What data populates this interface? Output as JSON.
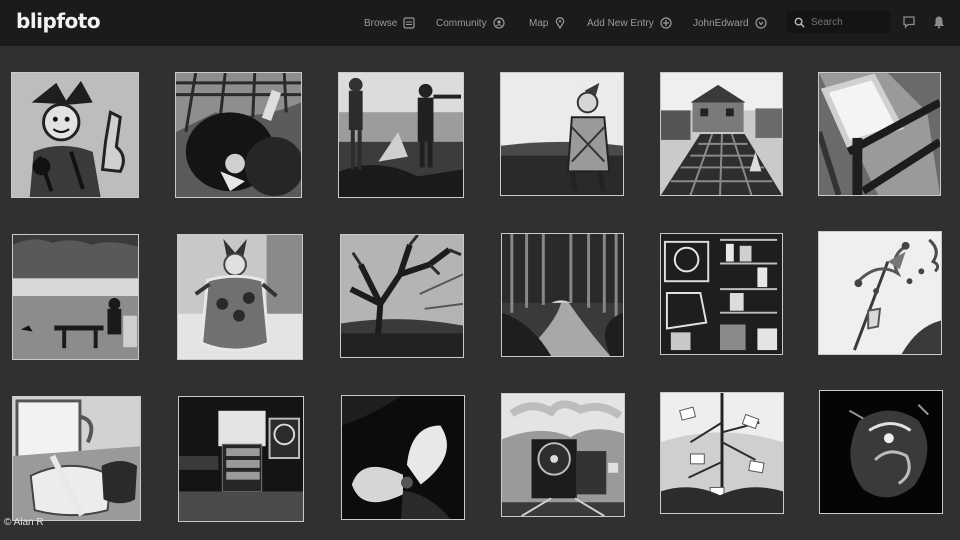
{
  "header": {
    "logo": "blipfoto",
    "nav": [
      {
        "label": "Browse",
        "icon": "browse-grid-icon"
      },
      {
        "label": "Community",
        "icon": "community-icon"
      },
      {
        "label": "Map",
        "icon": "map-pin-icon"
      },
      {
        "label": "Add New Entry",
        "icon": "add-circle-icon"
      },
      {
        "label": "JohnEdward",
        "icon": "user-menu-icon"
      }
    ],
    "search": {
      "placeholder": "Search",
      "icon": "search-icon"
    },
    "icons": [
      "messages-icon",
      "notifications-icon"
    ]
  },
  "gallery": {
    "photos": [
      {
        "subject": "jester-figure"
      },
      {
        "subject": "plaid-jester-toy"
      },
      {
        "subject": "boat-crew"
      },
      {
        "subject": "jester-doll-sitting"
      },
      {
        "subject": "house-garden-path"
      },
      {
        "subject": "window-frame"
      },
      {
        "subject": "picnic-by-river"
      },
      {
        "subject": "jester-in-jar"
      },
      {
        "subject": "bare-tree"
      },
      {
        "subject": "forest-path"
      },
      {
        "subject": "cluttered-shelves"
      },
      {
        "subject": "jester-drawing"
      },
      {
        "subject": "mug-and-spoon"
      },
      {
        "subject": "petrol-station-sign"
      },
      {
        "subject": "white-flower"
      },
      {
        "subject": "steam-locomotive"
      },
      {
        "subject": "card-tree"
      },
      {
        "subject": "glass-sculpture"
      }
    ]
  },
  "credit": "© Alan R"
}
